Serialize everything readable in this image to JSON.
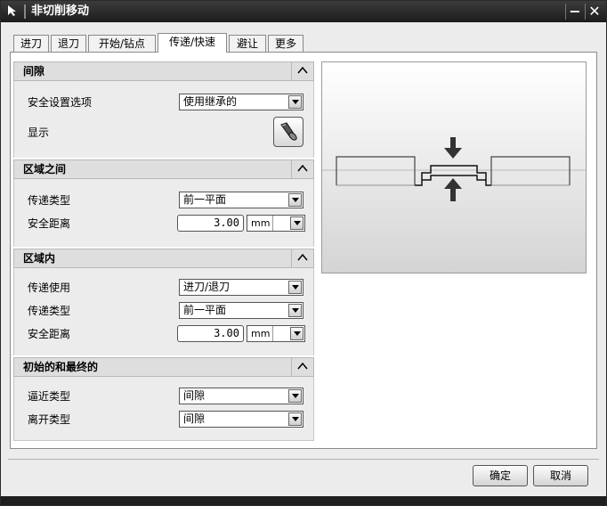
{
  "window": {
    "title": "非切削移动",
    "minimize_label": "−",
    "close_label": "✕"
  },
  "tabs": [
    {
      "label": "进刀",
      "active": false
    },
    {
      "label": "退刀",
      "active": false
    },
    {
      "label": "开始/钻点",
      "active": false
    },
    {
      "label": "传递/快速",
      "active": true
    },
    {
      "label": "避让",
      "active": false
    },
    {
      "label": "更多",
      "active": false
    }
  ],
  "groups": {
    "clearance": {
      "title": "间隙",
      "safety_option_label": "安全设置选项",
      "safety_option_value": "使用继承的",
      "display_label": "显示"
    },
    "between_regions": {
      "title": "区域之间",
      "transfer_type_label": "传递类型",
      "transfer_type_value": "前一平面",
      "safe_distance_label": "安全距离",
      "safe_distance_value": "3.00",
      "safe_distance_unit": "mm"
    },
    "within_region": {
      "title": "区域内",
      "transfer_use_label": "传递使用",
      "transfer_use_value": "进刀/退刀",
      "transfer_type_label": "传递类型",
      "transfer_type_value": "前一平面",
      "safe_distance_label": "安全距离",
      "safe_distance_value": "3.00",
      "safe_distance_unit": "mm"
    },
    "initial_final": {
      "title": "初始的和最终的",
      "approach_type_label": "逼近类型",
      "approach_type_value": "间隙",
      "departure_type_label": "离开类型",
      "departure_type_value": "间隙"
    }
  },
  "buttons": {
    "ok": "确定",
    "cancel": "取消"
  },
  "icons": {
    "title_icon": "cursor-arrow-icon",
    "collapse": "chevron-up-icon",
    "display": "flashlight-icon",
    "preview": "transfer-diagram-icon"
  }
}
